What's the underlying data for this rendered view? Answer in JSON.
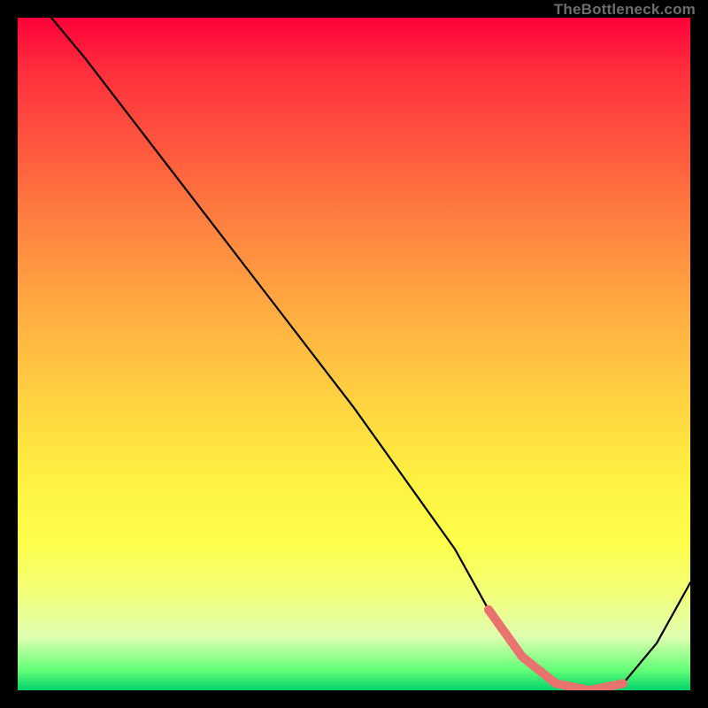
{
  "watermark": {
    "text": "TheBottleneck.com"
  },
  "chart_data": {
    "type": "line",
    "title": "",
    "xlabel": "",
    "ylabel": "",
    "xlim": [
      0,
      100
    ],
    "ylim": [
      0,
      100
    ],
    "grid": false,
    "legend": false,
    "annotations": [],
    "series": [
      {
        "name": "curve",
        "color": "#000000",
        "x": [
          5,
          10,
          20,
          30,
          40,
          50,
          60,
          65,
          70,
          75,
          80,
          85,
          90,
          95,
          100
        ],
        "values": [
          100,
          94,
          81,
          68,
          55,
          42,
          28,
          21,
          12,
          5,
          1,
          0,
          1,
          7,
          16
        ]
      },
      {
        "name": "highlight",
        "color": "#e9736e",
        "x": [
          70,
          75,
          80,
          85,
          90
        ],
        "values": [
          12,
          5,
          1,
          0,
          1
        ]
      }
    ]
  }
}
